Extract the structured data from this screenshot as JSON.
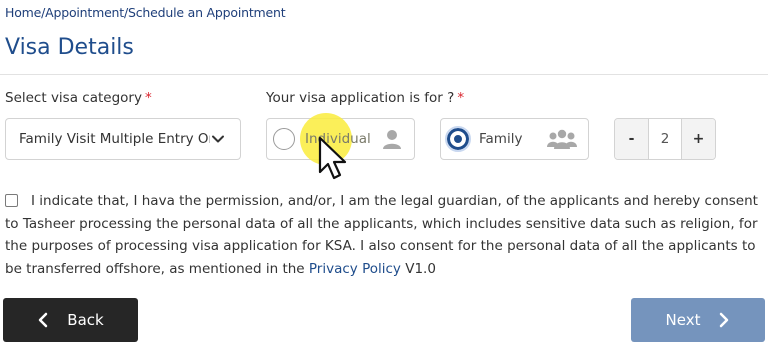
{
  "breadcrumb": "Home/Appointment/Schedule an Appointment",
  "page_title": "Visa Details",
  "category": {
    "label": "Select visa category",
    "required_mark": "*",
    "selected_value": "Family Visit Multiple Entry One",
    "icon": "chevron-down-icon"
  },
  "application_for": {
    "label": "Your visa application is for ?",
    "required_mark": "*",
    "options": [
      {
        "label": "Individual",
        "icon": "person-icon",
        "selected": false
      },
      {
        "label": "Family",
        "icon": "group-icon",
        "selected": true
      }
    ]
  },
  "applicant_count": {
    "minus_label": "-",
    "value": "2",
    "plus_label": "+"
  },
  "consent": {
    "text": "I indicate that, I hava the permission, and/or, I am the legal guardian, of the applicants and hereby consent to Tasheer processing the personal data of all the applicants, which includes sensitive data such as religion, for the purposes of processing visa application for KSA. I also consent for the personal data of all the applicants to be transferred offshore, as mentioned in the",
    "link_text": "Privacy Policy",
    "suffix": "V1.0",
    "checked": false
  },
  "buttons": {
    "back_label": "Back",
    "next_label": "Next"
  },
  "colors": {
    "brand_blue": "#1f4d8c",
    "required_red": "#d9232d",
    "back_button": "#262626",
    "next_button": "#7594bd",
    "click_highlight": "#faec3c"
  }
}
